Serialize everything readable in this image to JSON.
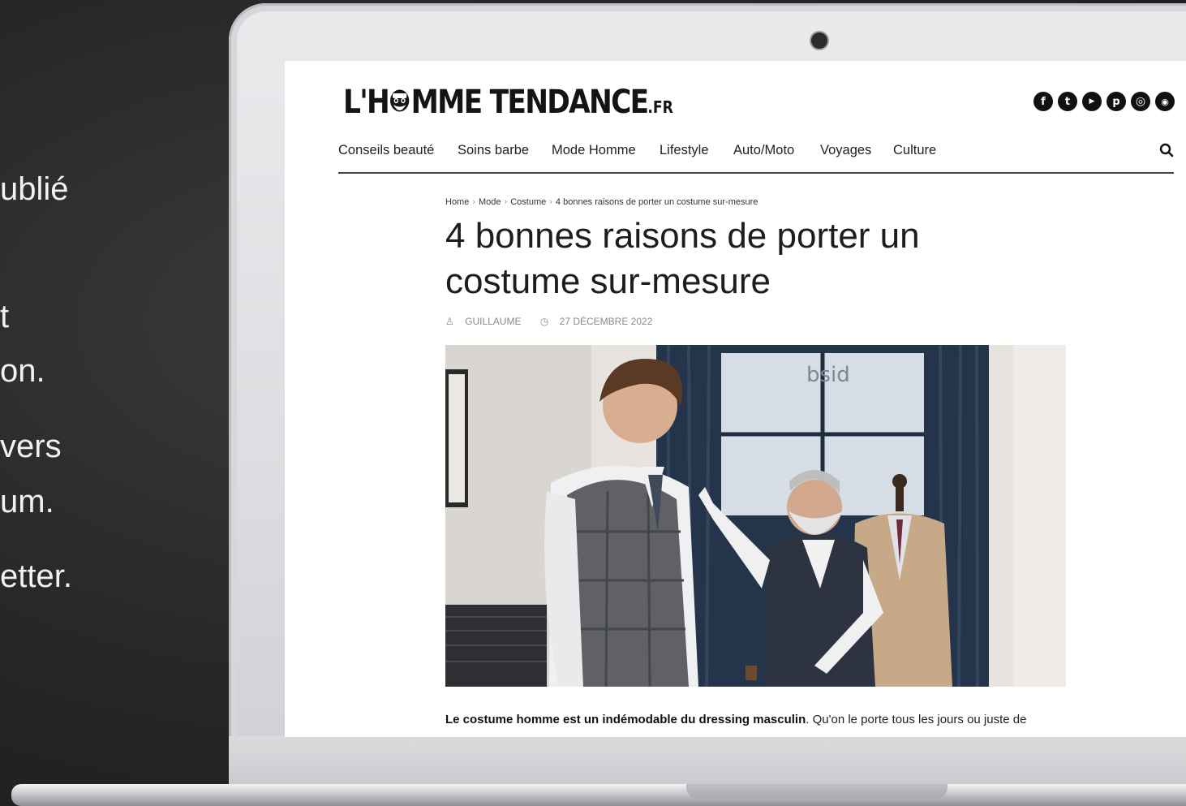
{
  "slide": {
    "lines": [
      "ublié",
      "t",
      "on.",
      "vers",
      "um.",
      "etter."
    ]
  },
  "site": {
    "logo_text": "L'H",
    "logo_text2": "MME TENDANCE",
    "logo_suffix": ".FR",
    "socials": [
      {
        "icon": "facebook-icon",
        "glyph": "f"
      },
      {
        "icon": "twitter-icon",
        "glyph": "t"
      },
      {
        "icon": "youtube-icon",
        "glyph": "▶"
      },
      {
        "icon": "pinterest-icon",
        "glyph": "p"
      },
      {
        "icon": "instagram-icon",
        "glyph": "◎"
      },
      {
        "icon": "rss-icon",
        "glyph": "◉"
      }
    ],
    "nav": [
      "Conseils beauté",
      "Soins barbe",
      "Mode Homme",
      "Lifestyle",
      "Auto/Moto",
      "Voyages",
      "Culture"
    ]
  },
  "article": {
    "breadcrumb": [
      "Home",
      "Mode",
      "Costume",
      "4 bonnes raisons de porter un costume sur-mesure"
    ],
    "title": "4 bonnes raisons de porter un costume sur-mesure",
    "author": "GUILLAUME",
    "date": "27 DÉCEMBRE 2022",
    "lead_bold": "Le costume homme est un indémodable du dressing masculin",
    "lead_rest": ". Qu'on le porte tous les jours ou juste de",
    "image_sign": "bsid"
  },
  "colors": {
    "text": "#222222",
    "accent": "#111111"
  }
}
